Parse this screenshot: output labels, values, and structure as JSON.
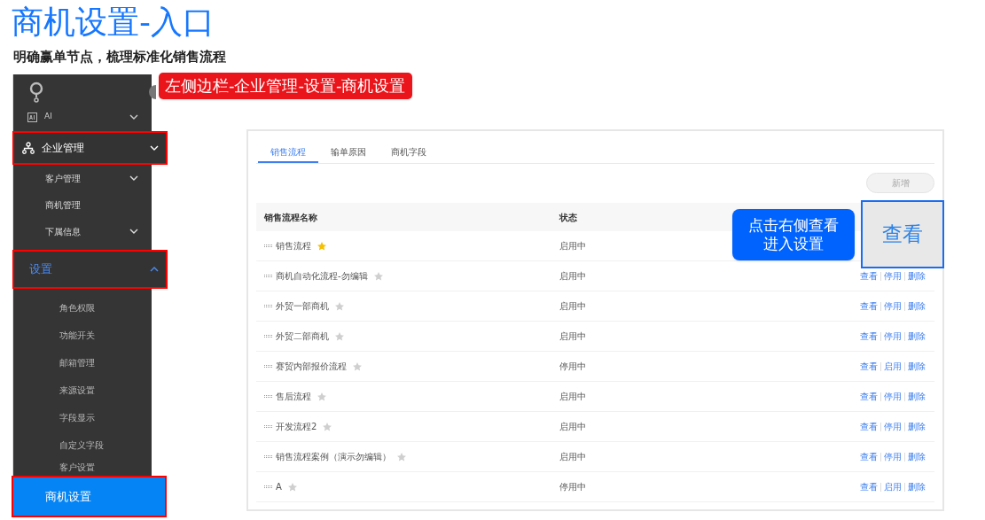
{
  "title": "商机设置-入口",
  "subtitle": "明确赢单节点，梳理标准化销售流程",
  "path_callout": "左侧边栏-企业管理-设置-商机设置",
  "sidebar": {
    "items": [
      {
        "label": "AI",
        "kind": "group",
        "expanded": false,
        "highlighted": false,
        "selected": false
      },
      {
        "label": "企业管理",
        "kind": "group",
        "expanded": false,
        "highlighted": true,
        "selected": false,
        "children": [
          {
            "label": "客户管理",
            "kind": "group",
            "expanded": false
          },
          {
            "label": "商机管理",
            "kind": "link"
          },
          {
            "label": "下属信息",
            "kind": "group",
            "expanded": false
          }
        ]
      },
      {
        "label": "设置",
        "kind": "group",
        "expanded": true,
        "highlighted": true,
        "selected": true,
        "children": [
          {
            "label": "角色权限",
            "kind": "link"
          },
          {
            "label": "功能开关",
            "kind": "link"
          },
          {
            "label": "邮箱管理",
            "kind": "link"
          },
          {
            "label": "来源设置",
            "kind": "link"
          },
          {
            "label": "字段显示",
            "kind": "link"
          },
          {
            "label": "自定义字段",
            "kind": "link"
          },
          {
            "label": "客户设置",
            "kind": "link"
          }
        ]
      }
    ],
    "current": "商机设置"
  },
  "panel": {
    "tabs": [
      {
        "label": "销售流程",
        "selected": true
      },
      {
        "label": "输单原因",
        "selected": false
      },
      {
        "label": "商机字段",
        "selected": false
      }
    ],
    "new_button": "新增",
    "table": {
      "columns": [
        "销售流程名称",
        "状态"
      ],
      "rows": [
        {
          "name": "销售流程",
          "starred": true,
          "status": "启用中",
          "actions": []
        },
        {
          "name": "商机自动化流程-勿编辑",
          "starred": false,
          "status": "启用中",
          "actions": [
            "查看",
            "停用",
            "删除"
          ]
        },
        {
          "name": "外贸一部商机",
          "starred": false,
          "status": "启用中",
          "actions": [
            "查看",
            "停用",
            "删除"
          ]
        },
        {
          "name": "外贸二部商机",
          "starred": false,
          "status": "启用中",
          "actions": [
            "查看",
            "停用",
            "删除"
          ]
        },
        {
          "name": "赛贸内部报价流程",
          "starred": false,
          "status": "停用中",
          "actions": [
            "查看",
            "启用",
            "删除"
          ]
        },
        {
          "name": "售后流程",
          "starred": false,
          "status": "启用中",
          "actions": [
            "查看",
            "停用",
            "删除"
          ]
        },
        {
          "name": "开发流程2",
          "starred": false,
          "status": "启用中",
          "actions": [
            "查看",
            "停用",
            "删除"
          ]
        },
        {
          "name": "销售流程案例（演示勿编辑）",
          "starred": false,
          "status": "启用中",
          "actions": [
            "查看",
            "停用",
            "删除"
          ]
        },
        {
          "name": "A",
          "starred": false,
          "status": "停用中",
          "actions": [
            "查看",
            "启用",
            "删除"
          ]
        }
      ]
    }
  },
  "hint_callout": [
    "点击右侧查看",
    "进入设置"
  ],
  "view_zoom": "查看"
}
